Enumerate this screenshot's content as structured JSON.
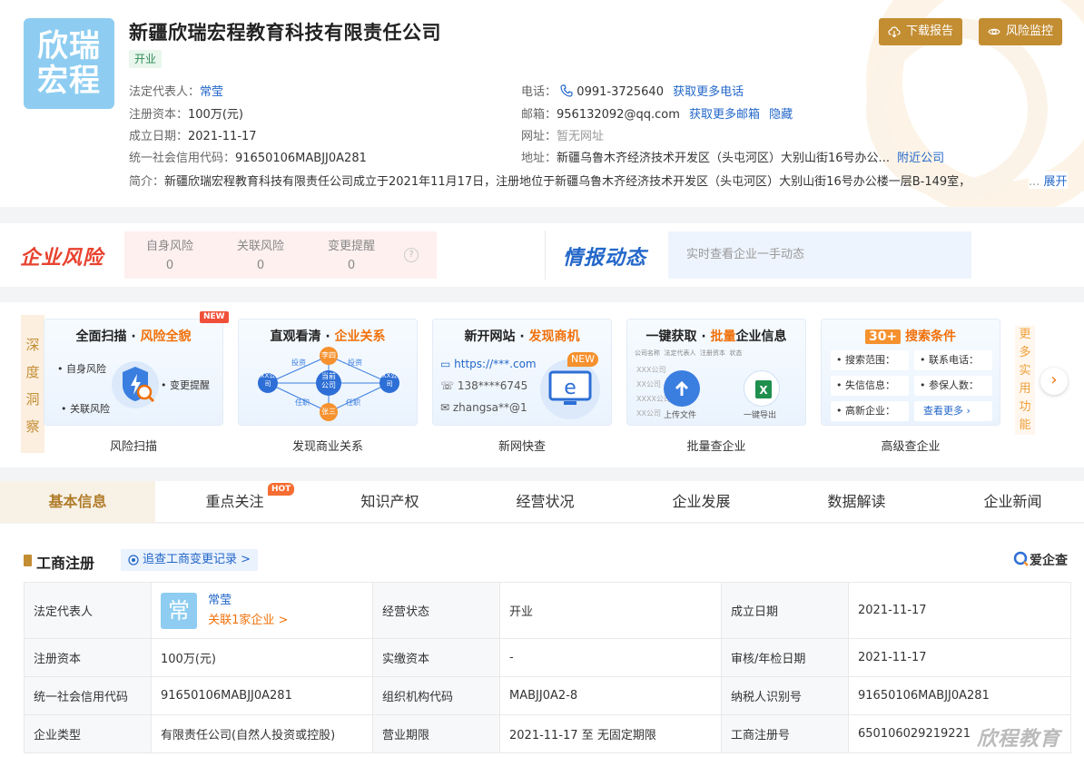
{
  "company": {
    "logo_line1": "欣瑞",
    "logo_line2": "宏程",
    "name": "新疆欣瑞宏程教育科技有限责任公司",
    "status": "开业",
    "legal_rep_label": "法定代表人：",
    "legal_rep": "常莹",
    "capital_label": "注册资本：",
    "capital": "100万(元)",
    "founded_label": "成立日期：",
    "founded": "2021-11-17",
    "credit_code_label": "统一社会信用代码：",
    "credit_code": "91650106MABJJ0A281",
    "phone_label": "电话：",
    "phone": "0991-3725640",
    "phone_more": "获取更多电话",
    "email_label": "邮箱：",
    "email": "956132092@qq.com",
    "email_more": "获取更多邮箱",
    "email_hide": "隐藏",
    "website_label": "网址：",
    "website": "暂无网址",
    "address_label": "地址：",
    "address": "新疆乌鲁木齐经济技术开发区（头屯河区）大别山街16号办公...",
    "address_nearby": "附近公司",
    "intro_label": "简介：",
    "intro": "新疆欣瑞宏程教育科技有限责任公司成立于2021年11月17日，注册地位于新疆乌鲁木齐经济技术开发区（头屯河区）大别山街16号办公楼一层B-149室，",
    "intro_ellipsis": "...",
    "intro_expand": "展开",
    "btn_download": "下载报告",
    "btn_monitor": "风险监控"
  },
  "risk": {
    "title": "企业风险",
    "items": [
      {
        "label": "自身风险",
        "count": "0"
      },
      {
        "label": "关联风险",
        "count": "0"
      },
      {
        "label": "变更提醒",
        "count": "0"
      }
    ],
    "help": "?",
    "info_title": "情报动态",
    "info_placeholder": "实时查看企业一手动态"
  },
  "insight": {
    "side_label": "深度洞察",
    "more_label": "更多实用功能",
    "cards": [
      {
        "title_a": "全面扫描",
        "title_b": "风险全貌",
        "badge": "NEW",
        "label": "风险扫描",
        "tags": [
          "自身风险",
          "变更提醒",
          "关联风险"
        ]
      },
      {
        "title_a": "直观看清",
        "title_b": "企业关系",
        "label": "发现商业关系",
        "nodes": [
          "李四",
          "当前公司",
          "张三",
          "XX公司",
          "XX公司"
        ],
        "edges": [
          "投资",
          "投资",
          "任职",
          "任职"
        ]
      },
      {
        "title_a": "新开网站",
        "title_b": "发现商机",
        "badge": "NEW",
        "label": "新网快查",
        "lines": [
          "https://***.com",
          "138****6745",
          "zhangsa**@1"
        ]
      },
      {
        "title_a": "一键获取",
        "title_b": "批量",
        "title_c": "企业信息",
        "label": "批量查企业",
        "headers": [
          "公司名称",
          "法定代表人",
          "注册资本",
          "状态"
        ],
        "rows": [
          "XXX公司",
          "XX公司",
          "XXXX公司",
          "XX公司"
        ],
        "upload": "上传文件",
        "export": "一键导出"
      },
      {
        "title_a": "30+",
        "title_b": "搜索条件",
        "label": "高级查企业",
        "conditions": [
          "搜索范围：",
          "联系电话：",
          "失信信息：",
          "参保人数：",
          "高新企业："
        ],
        "more": "查看更多"
      }
    ]
  },
  "tabs": [
    {
      "label": "基本信息",
      "active": true
    },
    {
      "label": "重点关注",
      "badge": "HOT"
    },
    {
      "label": "知识产权"
    },
    {
      "label": "经营状况"
    },
    {
      "label": "企业发展"
    },
    {
      "label": "数据解读"
    },
    {
      "label": "企业新闻"
    }
  ],
  "registration": {
    "title": "工商注册",
    "trace": "追查工商变更记录 >",
    "brand": "爱企查",
    "avatar_char": "常",
    "rep_name": "常莹",
    "rep_link": "关联1家企业 >",
    "rows": [
      [
        "法定代表人",
        "",
        "经营状态",
        "开业",
        "成立日期",
        "2021-11-17"
      ],
      [
        "注册资本",
        "100万(元)",
        "实缴资本",
        "-",
        "审核/年检日期",
        "2021-11-17"
      ],
      [
        "统一社会信用代码",
        "91650106MABJJ0A281",
        "组织机构代码",
        "MABJJ0A2-8",
        "纳税人识别号",
        "91650106MABJJ0A281"
      ],
      [
        "企业类型",
        "有限责任公司(自然人投资或控股)",
        "营业期限",
        "2021-11-17 至 无固定期限",
        "工商注册号",
        "650106029219221"
      ]
    ]
  },
  "watermark": "欣程教育",
  "colors": {
    "accent_gold": "#c38d32",
    "risk_red": "#e8422f",
    "link_blue": "#2367c9",
    "hot_orange": "#f56d33"
  }
}
